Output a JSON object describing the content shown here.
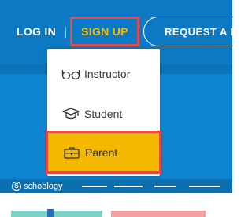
{
  "nav": {
    "login_label": "LOG IN",
    "signup_label": "SIGN UP",
    "request_label": "REQUEST A DEMO"
  },
  "signup_menu": {
    "items": [
      {
        "label": "Instructor",
        "icon": "glasses-icon"
      },
      {
        "label": "Student",
        "icon": "graduation-cap-icon"
      },
      {
        "label": "Parent",
        "icon": "briefcase-icon",
        "highlighted": true
      }
    ]
  },
  "footer": {
    "logo_text": "schoology",
    "logo_badge": "S"
  },
  "colors": {
    "header_blue": "#0b79c4",
    "signup_yellow": "#f5b800",
    "highlight_red": "#e64b4b",
    "parent_highlight": "#f5b800"
  }
}
